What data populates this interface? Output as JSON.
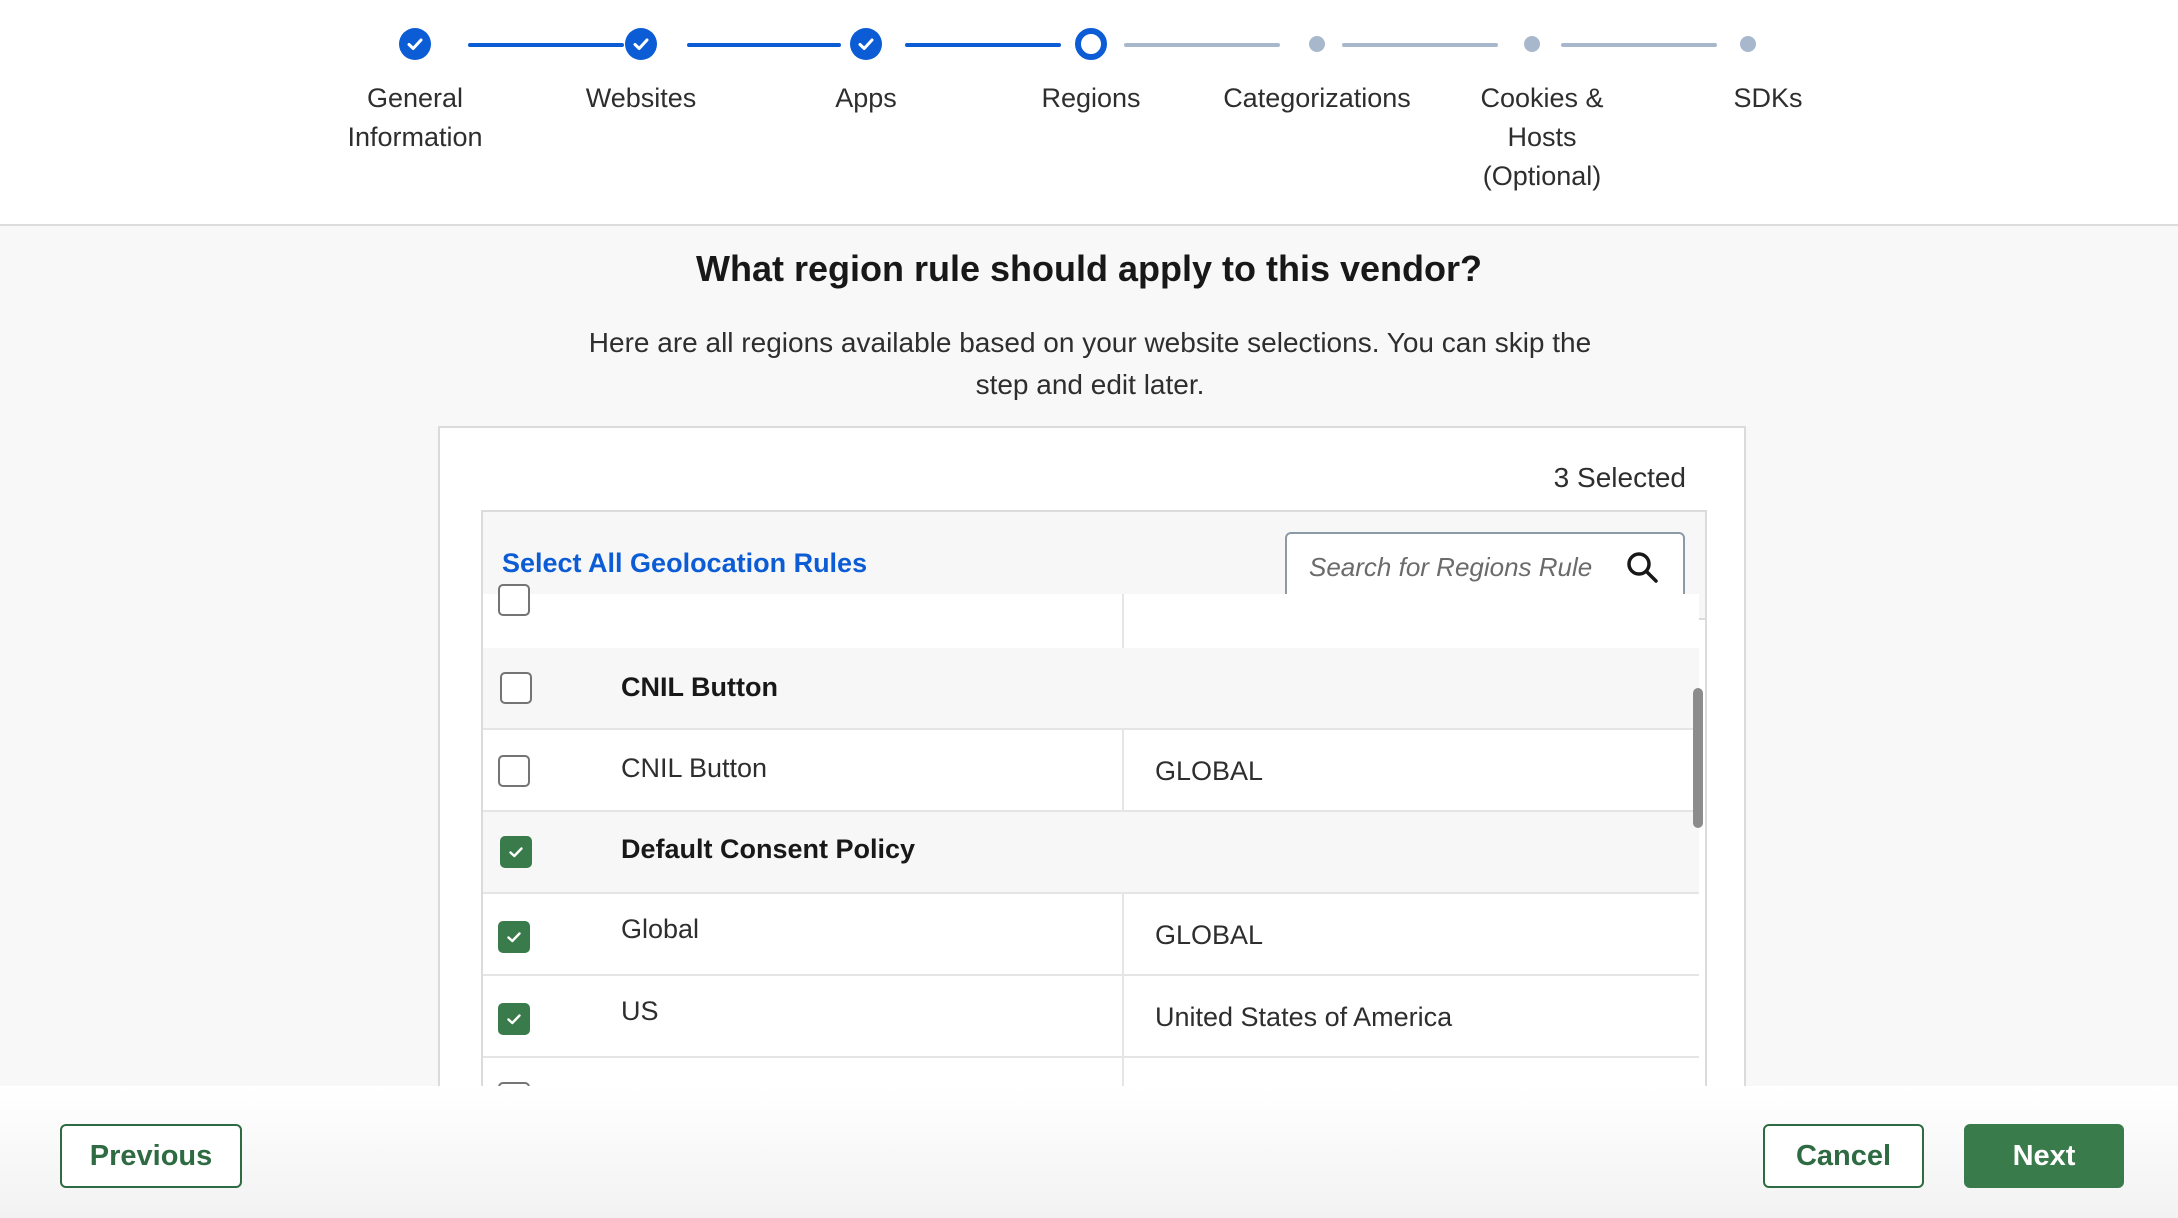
{
  "stepper": {
    "steps": [
      {
        "label": "General\nInformation",
        "state": "done"
      },
      {
        "label": "Websites",
        "state": "done"
      },
      {
        "label": "Apps",
        "state": "done"
      },
      {
        "label": "Regions",
        "state": "current"
      },
      {
        "label": "Categorizations",
        "state": "todo"
      },
      {
        "label": "Cookies &\nHosts\n(Optional)",
        "state": "todo"
      },
      {
        "label": "SDKs",
        "state": "todo"
      }
    ]
  },
  "main": {
    "heading": "What region rule should apply to this vendor?",
    "subtext": "Here are all regions available based on your website selections. You can skip the step and edit later.",
    "selected_count": "3 Selected",
    "select_all_label": "Select All Geolocation Rules",
    "search_placeholder": "Search for Regions Rule"
  },
  "rows": [
    {
      "type": "group",
      "name": "CNIL Button",
      "region": "",
      "checked": false
    },
    {
      "type": "child",
      "name": "CNIL Button",
      "region": "GLOBAL",
      "checked": false
    },
    {
      "type": "group",
      "name": "Default Consent Policy",
      "region": "",
      "checked": true
    },
    {
      "type": "child",
      "name": "Global",
      "region": "GLOBAL",
      "checked": true
    },
    {
      "type": "child",
      "name": "US",
      "region": "United States of America",
      "checked": true
    }
  ],
  "footer": {
    "previous_label": "Previous",
    "cancel_label": "Cancel",
    "next_label": "Next"
  },
  "colors": {
    "accent_blue": "#0b5cd5",
    "success_green": "#3a7b4c"
  }
}
